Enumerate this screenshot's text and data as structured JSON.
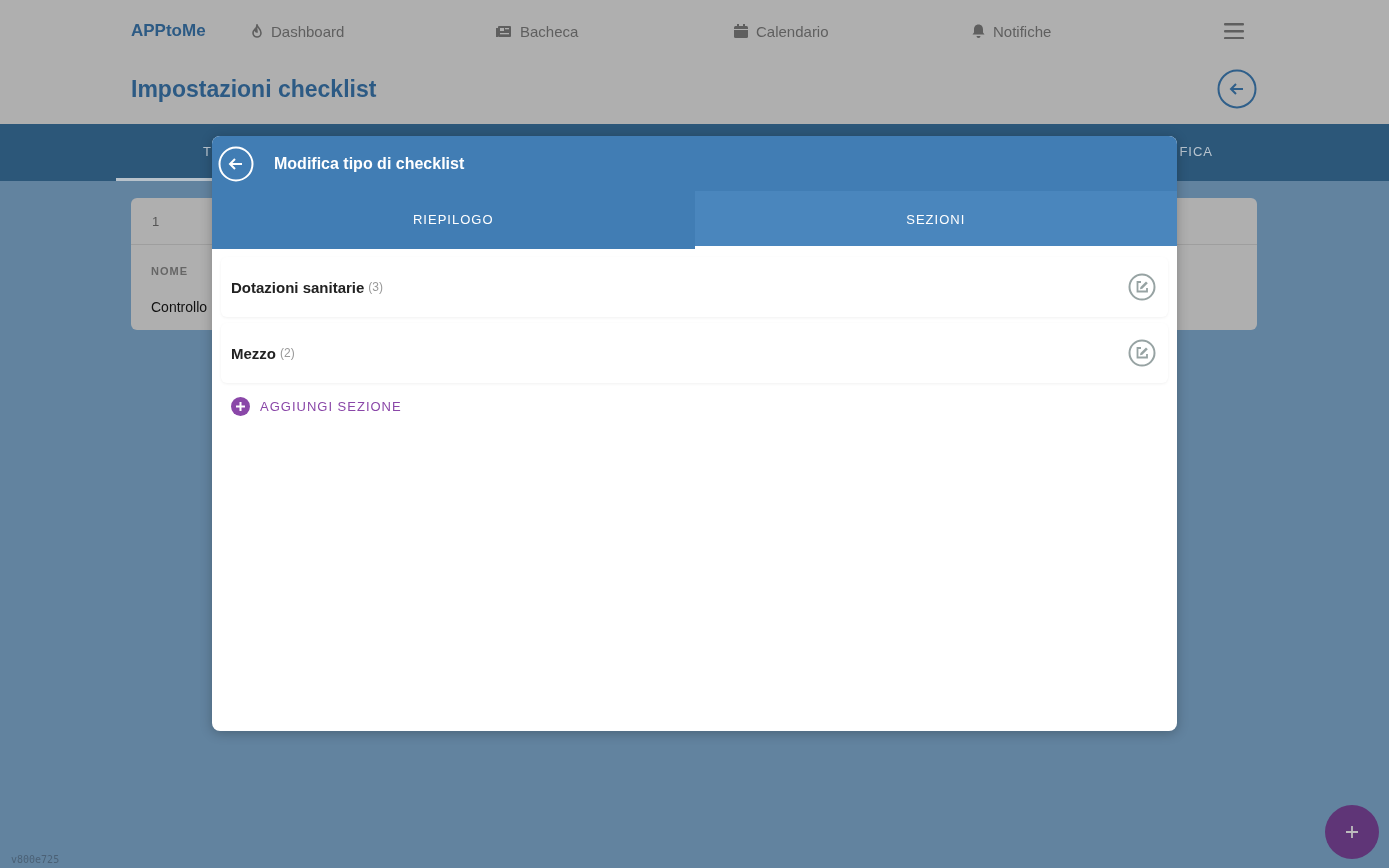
{
  "app": {
    "logo": "APPtoMe",
    "nav": [
      {
        "label": "Dashboard"
      },
      {
        "label": "Bacheca"
      },
      {
        "label": "Calendario"
      },
      {
        "label": "Notifiche"
      }
    ]
  },
  "page": {
    "title": "Impostazioni checklist",
    "tabs": [
      {
        "label": "T",
        "selected": true
      },
      {
        "label": "FICA",
        "selected": false
      }
    ],
    "card": {
      "column_1": "1",
      "header": "NOME",
      "cell": "Controllo"
    }
  },
  "modal": {
    "title": "Modifica tipo di checklist",
    "tabs": [
      {
        "label": "RIEPILOGO",
        "selected": false
      },
      {
        "label": "SEZIONI",
        "selected": true
      }
    ],
    "sections": [
      {
        "name": "Dotazioni sanitarie",
        "count": "(3)"
      },
      {
        "name": "Mezzo",
        "count": "(2)"
      }
    ],
    "add_label": "AGGIUNGI SEZIONE"
  },
  "version": "v800e725"
}
